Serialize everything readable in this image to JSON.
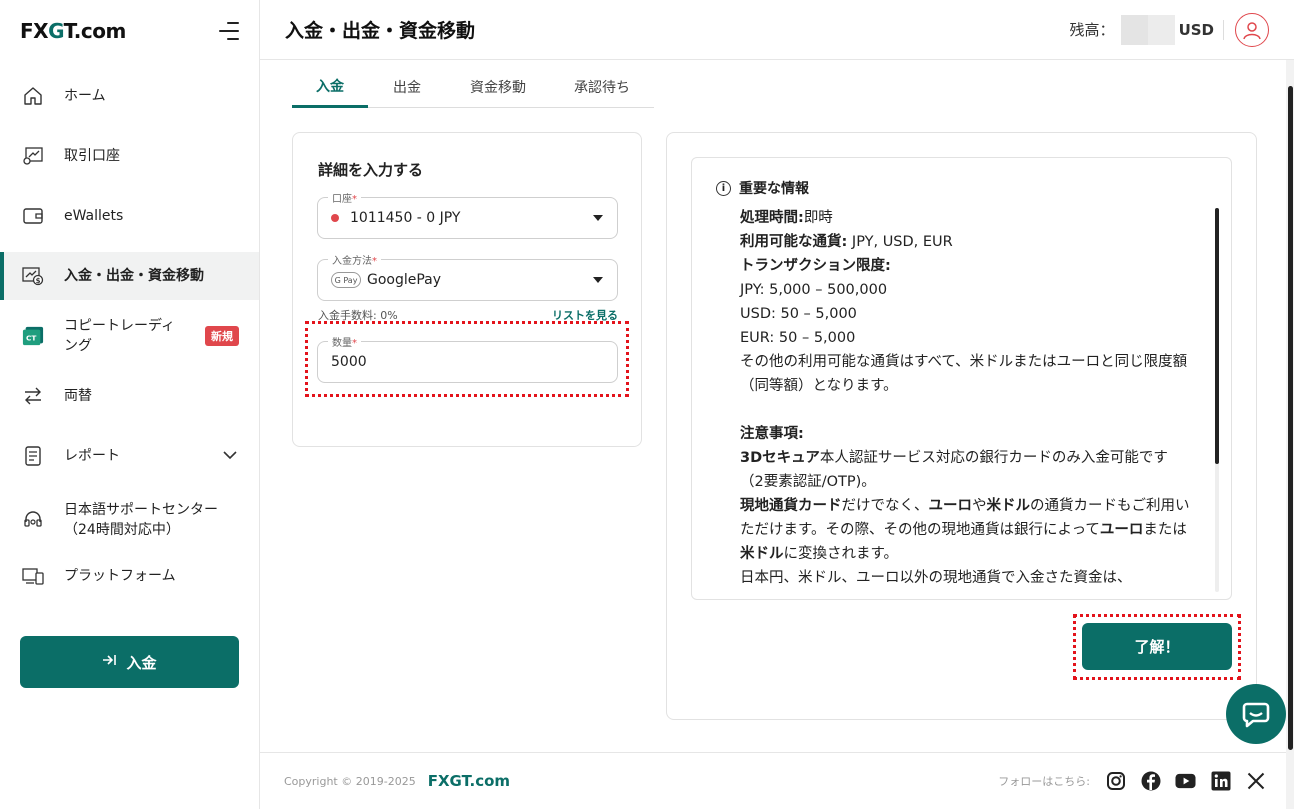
{
  "brand": {
    "logo_left": "FX",
    "logo_g": "G",
    "logo_right": "T.com"
  },
  "sidebar": {
    "items": [
      {
        "label": "ホーム",
        "icon": "home-icon"
      },
      {
        "label": "取引口座",
        "icon": "trading-account-icon"
      },
      {
        "label": "eWallets",
        "icon": "wallet-icon"
      },
      {
        "label": "入金・出金・資金移動",
        "icon": "deposit-withdraw-icon",
        "active": true
      },
      {
        "label": "コピートレーディング",
        "icon": "copy-trading-icon",
        "badge": "新規"
      },
      {
        "label": "両替",
        "icon": "exchange-icon"
      },
      {
        "label": "レポート",
        "icon": "report-icon"
      },
      {
        "label": "日本語サポートセンター（24時間対応中）",
        "icon": "support-icon"
      },
      {
        "label": "プラットフォーム",
        "icon": "platform-icon"
      }
    ],
    "deposit_button": "入金"
  },
  "header": {
    "title": "入金・出金・資金移動",
    "balance_label": "残高：",
    "balance_currency": "USD"
  },
  "tabs": [
    "入金",
    "出金",
    "資金移動",
    "承認待ち"
  ],
  "form": {
    "title": "詳細を入力する",
    "account_label": "口座",
    "account_value": "1011450 - 0 JPY",
    "method_label": "入金方法",
    "method_value": "GooglePay",
    "method_badge": "G Pay",
    "fee_text": "入金手数料: 0%",
    "list_link": "リストを見る",
    "amount_label": "数量",
    "amount_value": "5000",
    "required_mark": "*"
  },
  "info": {
    "heading": "重要な情報",
    "lines": {
      "l1_b": "処理時間:",
      "l1": "即時",
      "l2_b": "利用可能な通貨:",
      "l2": " JPY, USD, EUR",
      "l3_b": "トランザクション限度:",
      "l4": "JPY: 5,000 – 500,000",
      "l5": "USD: 50 – 5,000",
      "l6": "EUR: 50 – 5,000",
      "l7": "その他の利用可能な通貨はすべて、米ドルまたはユーロと同じ限度額（同等額）となります。",
      "l8_b": "注意事項:",
      "l9_b": "3Dセキュア",
      "l9": "本人認証サービス対応の銀行カードのみ入金可能です（2要素認証/OTP)。",
      "l10_b1": "現地通貨カード",
      "l10_a": "だけでなく、",
      "l10_b2": "ユーロ",
      "l10_c": "や",
      "l10_b3": "米ドル",
      "l10_d": "の通貨カードもご利用いただけます。その際、その他の現地通貨は銀行によって",
      "l10_b4": "ユーロ",
      "l10_e": "または",
      "l10_b5": "米ドル",
      "l10_f": "に変換されます。",
      "l11": "日本円、米ドル、ユーロ以外の現地通貨で入金さた資金は、"
    },
    "ok_button": "了解！"
  },
  "footer": {
    "copyright": "Copyright © 2019-2025",
    "brand": "FXGT.com",
    "follow": "フォローはこちら:",
    "socials": [
      "instagram-icon",
      "facebook-icon",
      "youtube-icon",
      "linkedin-icon",
      "x-icon"
    ]
  },
  "colors": {
    "accent": "#0b6e67",
    "alert": "#e0474c",
    "highlight": "#e3131b"
  }
}
